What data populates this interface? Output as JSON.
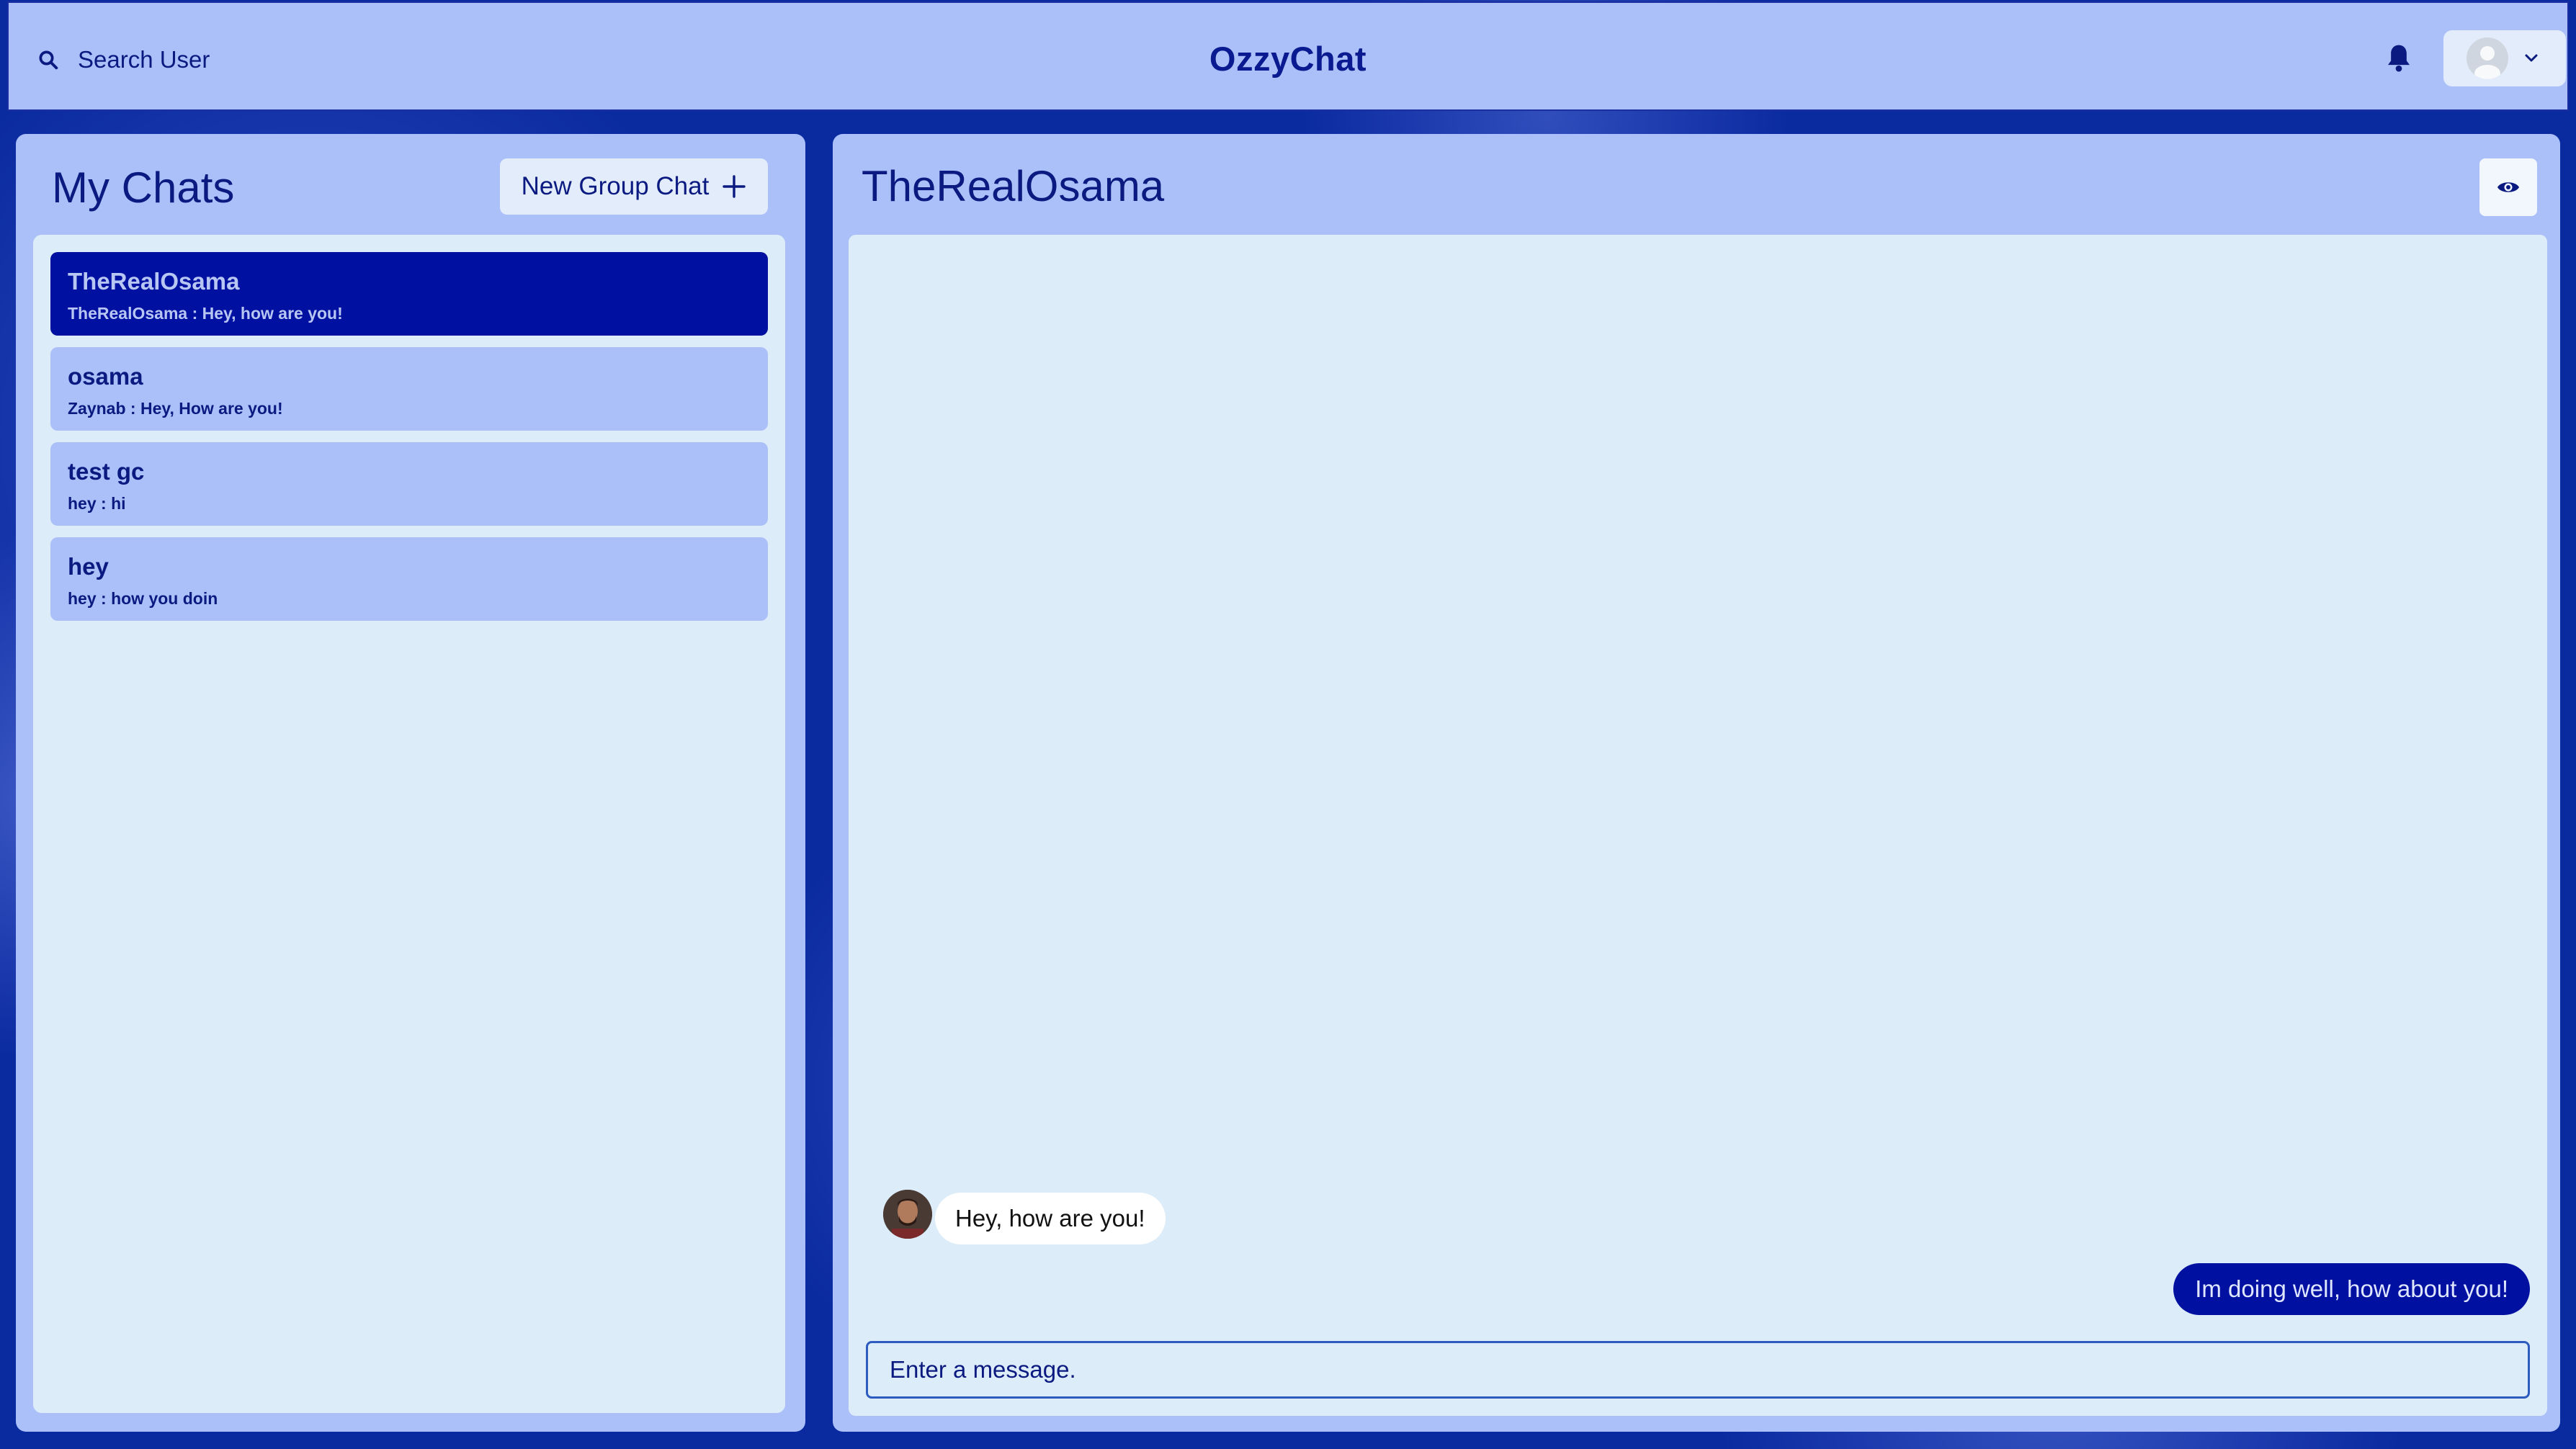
{
  "header": {
    "search_label": "Search User",
    "brand": "OzzyChat",
    "icons": {
      "search": "search-icon",
      "bell": "bell-icon",
      "avatar": "avatar-placeholder",
      "chevron": "chevron-down-icon"
    }
  },
  "sidebar": {
    "title": "My Chats",
    "new_group_label": "New Group Chat",
    "chats": [
      {
        "name": "TheRealOsama",
        "preview": "TheRealOsama : Hey, how are you!",
        "active": true
      },
      {
        "name": "osama",
        "preview": "Zaynab : Hey, How are you!",
        "active": false
      },
      {
        "name": "test gc",
        "preview": "hey : hi",
        "active": false
      },
      {
        "name": "hey",
        "preview": "hey : how you doin",
        "active": false
      }
    ]
  },
  "chat": {
    "title": "TheRealOsama",
    "messages": [
      {
        "text": "Hey, how are you!",
        "direction": "incoming"
      },
      {
        "text": "Im doing well, how about you!",
        "direction": "outgoing"
      }
    ],
    "input_placeholder": "Enter a message."
  },
  "colors": {
    "accent": "#0010a0",
    "panel": "#abc0f8",
    "surface": "#dcecf8",
    "text": "#0a1a80"
  }
}
